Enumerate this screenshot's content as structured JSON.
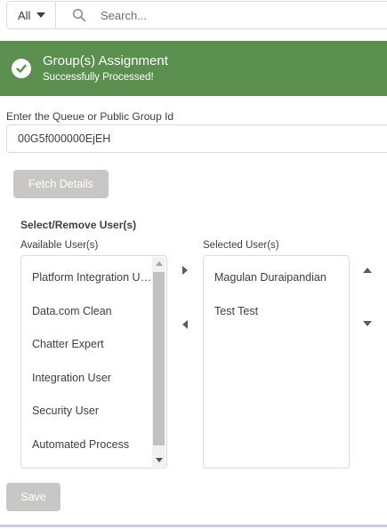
{
  "search": {
    "scope_label": "All",
    "placeholder": "Search..."
  },
  "toast": {
    "title": "Group(s) Assignment",
    "message": "Successfully Processed!",
    "color": "#5a8f50"
  },
  "form": {
    "id_label": "Enter the Queue or Public Group Id",
    "id_value": "00G5f000000EjEH",
    "fetch_label": "Fetch Details"
  },
  "dual_listbox": {
    "title": "Select/Remove User(s)",
    "available_label": "Available User(s)",
    "selected_label": "Selected User(s)",
    "available_options": [
      "Platform Integration User",
      "Data.com Clean",
      "Chatter Expert",
      "Integration User",
      "Security User",
      "Automated Process"
    ],
    "selected_options": [
      "Magulan Duraipandian",
      "Test Test"
    ]
  },
  "footer": {
    "save_label": "Save"
  },
  "icons": {
    "search": "search-icon",
    "success": "success-check-icon",
    "scope_caret": "chevron-down-icon"
  }
}
